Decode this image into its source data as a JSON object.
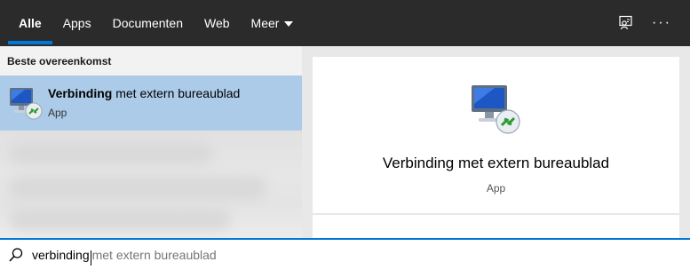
{
  "tabs": [
    {
      "label": "Alle",
      "active": true
    },
    {
      "label": "Apps",
      "active": false
    },
    {
      "label": "Documenten",
      "active": false
    },
    {
      "label": "Web",
      "active": false
    },
    {
      "label": "Meer",
      "active": false,
      "dropdown": true
    }
  ],
  "top_actions": {
    "feedback_icon": "feedback-icon",
    "more_label": "···"
  },
  "results": {
    "section_header": "Beste overeenkomst",
    "best_match": {
      "title_bold": "Verbinding",
      "title_rest": " met extern bureaublad",
      "subtitle": "App",
      "icon": "remote-desktop-icon"
    }
  },
  "detail": {
    "title": "Verbinding met extern bureaublad",
    "subtitle": "App",
    "icon": "remote-desktop-icon"
  },
  "search": {
    "typed": "verbinding",
    "suggestion": " met extern bureaublad",
    "icon": "search-icon"
  },
  "colors": {
    "topbar": "#2b2b2b",
    "accent": "#0078d7",
    "selected": "#accbe9"
  }
}
